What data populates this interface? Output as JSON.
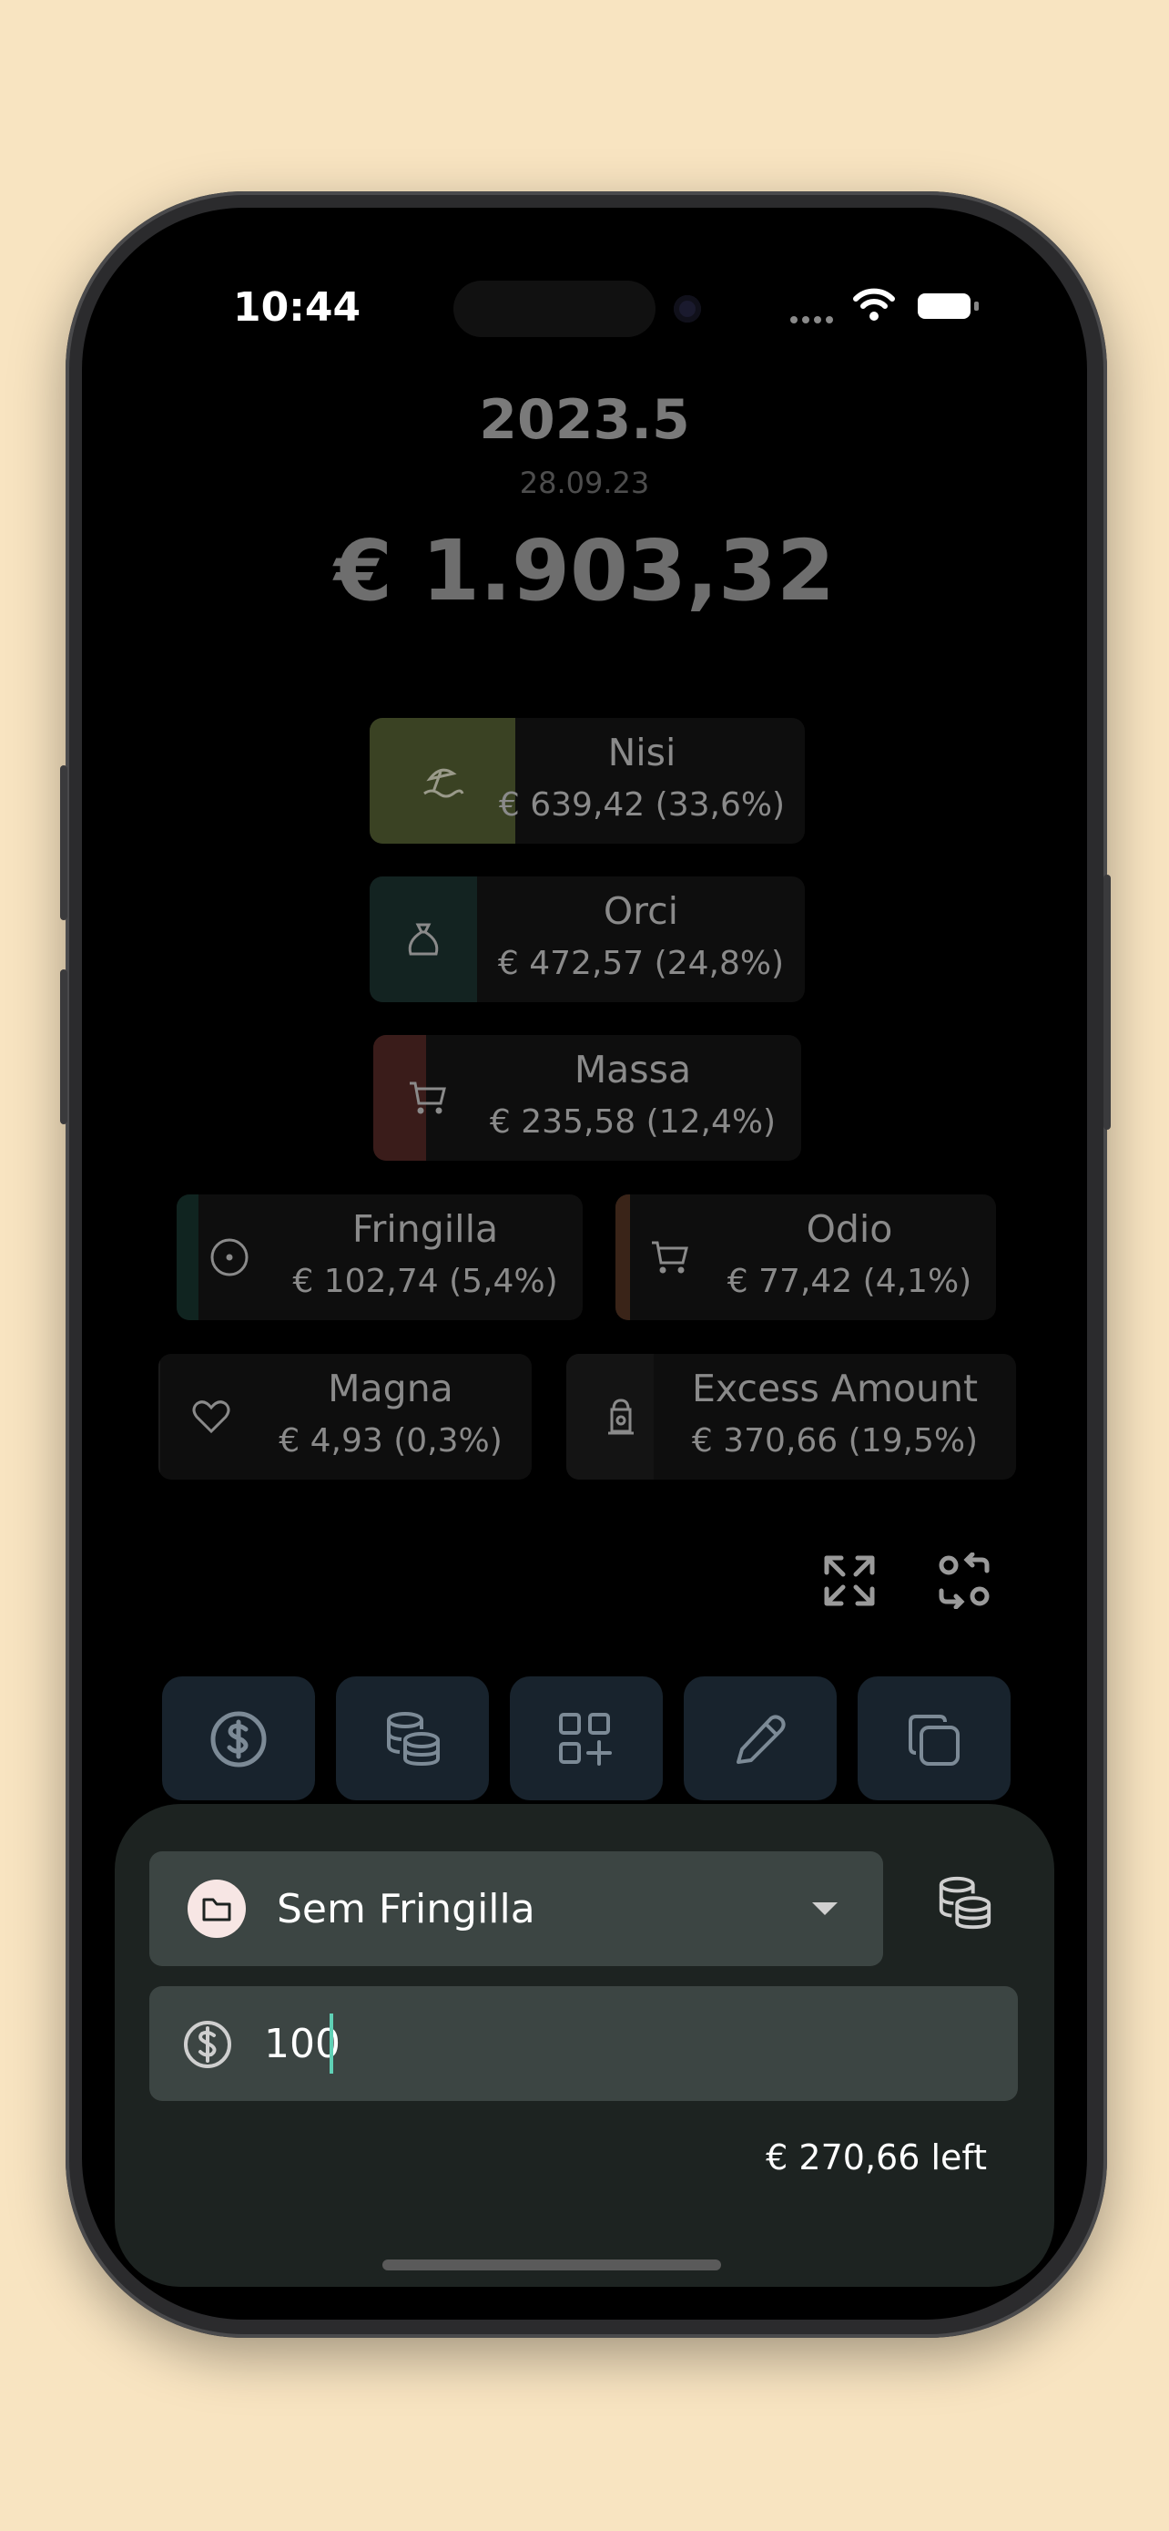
{
  "status_bar": {
    "time": "10:44"
  },
  "header": {
    "period": "2023.5",
    "date": "28.09.23",
    "total": "€ 1.903,32"
  },
  "categories": [
    {
      "name": "Nisi",
      "amount": "€ 639,42 (33,6%)",
      "icon": "beach-umbrella-icon",
      "color": "#3a4223",
      "share": 0.336
    },
    {
      "name": "Orci",
      "amount": "€ 472,57 (24,8%)",
      "icon": "money-bag-icon",
      "color": "#132321",
      "share": 0.248
    },
    {
      "name": "Massa",
      "amount": "€ 235,58 (12,4%)",
      "icon": "shopping-cart-icon",
      "color": "#3a1c1a",
      "share": 0.124
    },
    {
      "name": "Fringilla",
      "amount": "€ 102,74 (5,4%)",
      "icon": "target-icon",
      "color": "#102420",
      "share": 0.054
    },
    {
      "name": "Odio",
      "amount": "€ 77,42 (4,1%)",
      "icon": "shopping-cart-icon",
      "color": "#3a2418",
      "share": 0.041
    },
    {
      "name": "Magna",
      "amount": "€ 4,93 (0,3%)",
      "icon": "heart-icon",
      "color": "#1a1a1a",
      "share": 0.003
    },
    {
      "name": "Excess Amount",
      "amount": "€ 370,66 (19,5%)",
      "icon": "fire-hydrant-icon",
      "color": "#141414",
      "share": 0.195
    }
  ],
  "toolbar": {
    "expand_icon": "expand-icon",
    "swap_icon": "swap-icon"
  },
  "actions": [
    "dollar-icon",
    "coins-icon",
    "grid-add-icon",
    "pencil-icon",
    "copy-icon"
  ],
  "sheet": {
    "category_select": {
      "value": "Sem Fringilla",
      "icon": "folder-icon"
    },
    "amount_input": {
      "value": "100",
      "icon": "dollar-circle-icon"
    },
    "remaining": "€ 270,66 left"
  }
}
